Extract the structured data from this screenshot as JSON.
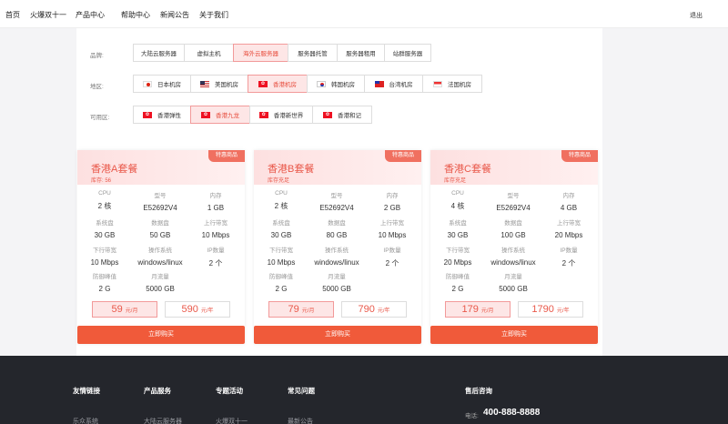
{
  "nav": {
    "items": [
      "首页",
      "火爆双十一",
      "产品中心",
      "帮助中心",
      "新闻公告",
      "关于我们"
    ],
    "logout": "退出"
  },
  "filters": {
    "brand": {
      "label": "品牌:",
      "options": [
        "大陆云服务器",
        "虚拟主机",
        "海外云服务器",
        "服务器托管",
        "服务器租用",
        "站群服务器"
      ],
      "selected": "海外云服务器"
    },
    "region": {
      "label": "地区:",
      "options": [
        {
          "name": "日本机房",
          "flag": "jp"
        },
        {
          "name": "美国机房",
          "flag": "us"
        },
        {
          "name": "香港机房",
          "flag": "hk"
        },
        {
          "name": "韩国机房",
          "flag": "kr"
        },
        {
          "name": "台湾机房",
          "flag": "tw"
        },
        {
          "name": "法国机房",
          "flag": "fr"
        }
      ],
      "selected": "香港机房"
    },
    "zone": {
      "label": "可用区:",
      "options": [
        {
          "name": "香港弹性",
          "flag": "hk"
        },
        {
          "name": "香港九龙",
          "flag": "hk"
        },
        {
          "name": "香港新世界",
          "flag": "hk"
        },
        {
          "name": "香港和记",
          "flag": "hk"
        }
      ],
      "selected": "香港九龙"
    }
  },
  "cards": [
    {
      "badge": "特惠商品",
      "title": "香港A套餐",
      "stock": "库存: 56",
      "specs": [
        {
          "k": "CPU",
          "v": "2 核"
        },
        {
          "k": "型号",
          "v": "E52692V4"
        },
        {
          "k": "内存",
          "v": "1 GB"
        },
        {
          "k": "系统盘",
          "v": "30 GB"
        },
        {
          "k": "数据盘",
          "v": "50 GB"
        },
        {
          "k": "上行带宽",
          "v": "10 Mbps"
        },
        {
          "k": "下行带宽",
          "v": "10 Mbps"
        },
        {
          "k": "操作系统",
          "v": "windows/linux"
        },
        {
          "k": "IP数量",
          "v": "2 个"
        },
        {
          "k": "防御峰值",
          "v": "2 G"
        },
        {
          "k": "月流量",
          "v": "5000 GB"
        }
      ],
      "price_month": "59",
      "unit_month": "元/月",
      "price_year": "590",
      "unit_year": "元/年",
      "buy": "立即购买"
    },
    {
      "badge": "特惠商品",
      "title": "香港B套餐",
      "stock": "库存充足",
      "specs": [
        {
          "k": "CPU",
          "v": "2 核"
        },
        {
          "k": "型号",
          "v": "E52692V4"
        },
        {
          "k": "内存",
          "v": "2 GB"
        },
        {
          "k": "系统盘",
          "v": "30 GB"
        },
        {
          "k": "数据盘",
          "v": "80 GB"
        },
        {
          "k": "上行带宽",
          "v": "10 Mbps"
        },
        {
          "k": "下行带宽",
          "v": "10 Mbps"
        },
        {
          "k": "操作系统",
          "v": "windows/linux"
        },
        {
          "k": "IP数量",
          "v": "2 个"
        },
        {
          "k": "防御峰值",
          "v": "2 G"
        },
        {
          "k": "月流量",
          "v": "5000 GB"
        }
      ],
      "price_month": "79",
      "unit_month": "元/月",
      "price_year": "790",
      "unit_year": "元/年",
      "buy": "立即购买"
    },
    {
      "badge": "特惠商品",
      "title": "香港C套餐",
      "stock": "库存充足",
      "specs": [
        {
          "k": "CPU",
          "v": "4 核"
        },
        {
          "k": "型号",
          "v": "E52692V4"
        },
        {
          "k": "内存",
          "v": "4 GB"
        },
        {
          "k": "系统盘",
          "v": "30 GB"
        },
        {
          "k": "数据盘",
          "v": "100 GB"
        },
        {
          "k": "上行带宽",
          "v": "20 Mbps"
        },
        {
          "k": "下行带宽",
          "v": "20 Mbps"
        },
        {
          "k": "操作系统",
          "v": "windows/linux"
        },
        {
          "k": "IP数量",
          "v": "2 个"
        },
        {
          "k": "防御峰值",
          "v": "2 G"
        },
        {
          "k": "月流量",
          "v": "5000 GB"
        }
      ],
      "price_month": "179",
      "unit_month": "元/月",
      "price_year": "1790",
      "unit_year": "元/年",
      "buy": "立即购买"
    }
  ],
  "footer": {
    "columns": [
      {
        "title": "友情链接",
        "link": "乐众系统"
      },
      {
        "title": "产品服务",
        "link": "大陆云服务器"
      },
      {
        "title": "专题活动",
        "link": "火爆双十一"
      },
      {
        "title": "常见问题",
        "link": "最新公告"
      }
    ],
    "support_title": "售后咨询",
    "hotline_label": "电话:",
    "hotline": "400-888-8888"
  },
  "colors": {
    "accent": "#f05a3a",
    "accent_text": "#e9584a",
    "footer_bg": "#24262c"
  }
}
